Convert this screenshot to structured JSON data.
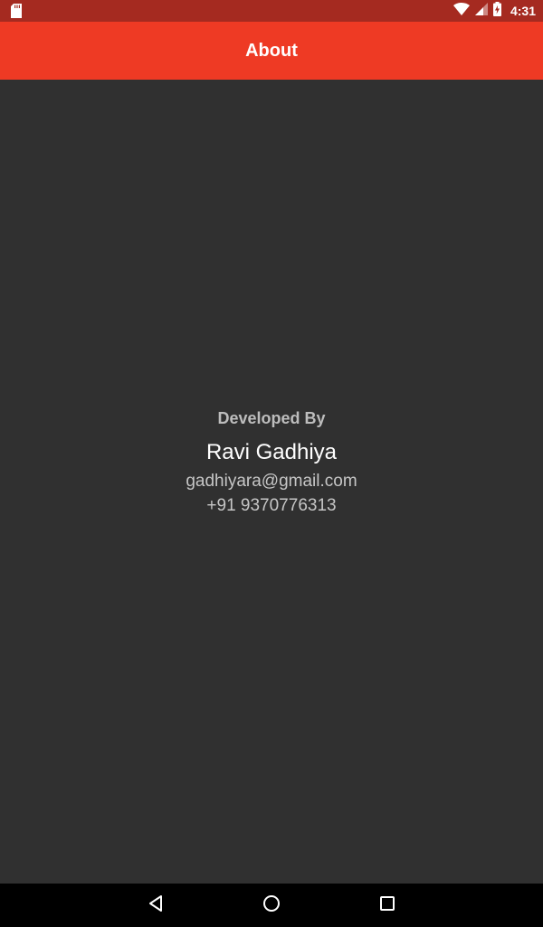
{
  "status_bar": {
    "time": "4:31",
    "icons": [
      "sd-card-icon",
      "wifi-icon",
      "cell-signal-icon",
      "battery-charging-icon"
    ]
  },
  "app_bar": {
    "title": "About"
  },
  "credits": {
    "heading": "Developed By",
    "name": "Ravi Gadhiya",
    "email": "gadhiyara@gmail.com",
    "phone": "+91 9370776313"
  },
  "nav_bar": {
    "buttons": [
      "back-icon",
      "home-icon",
      "recents-icon"
    ]
  },
  "colors": {
    "status_bar": "#a52a20",
    "app_bar": "#ee3a24",
    "background": "#303030",
    "nav_bar": "#000000"
  }
}
